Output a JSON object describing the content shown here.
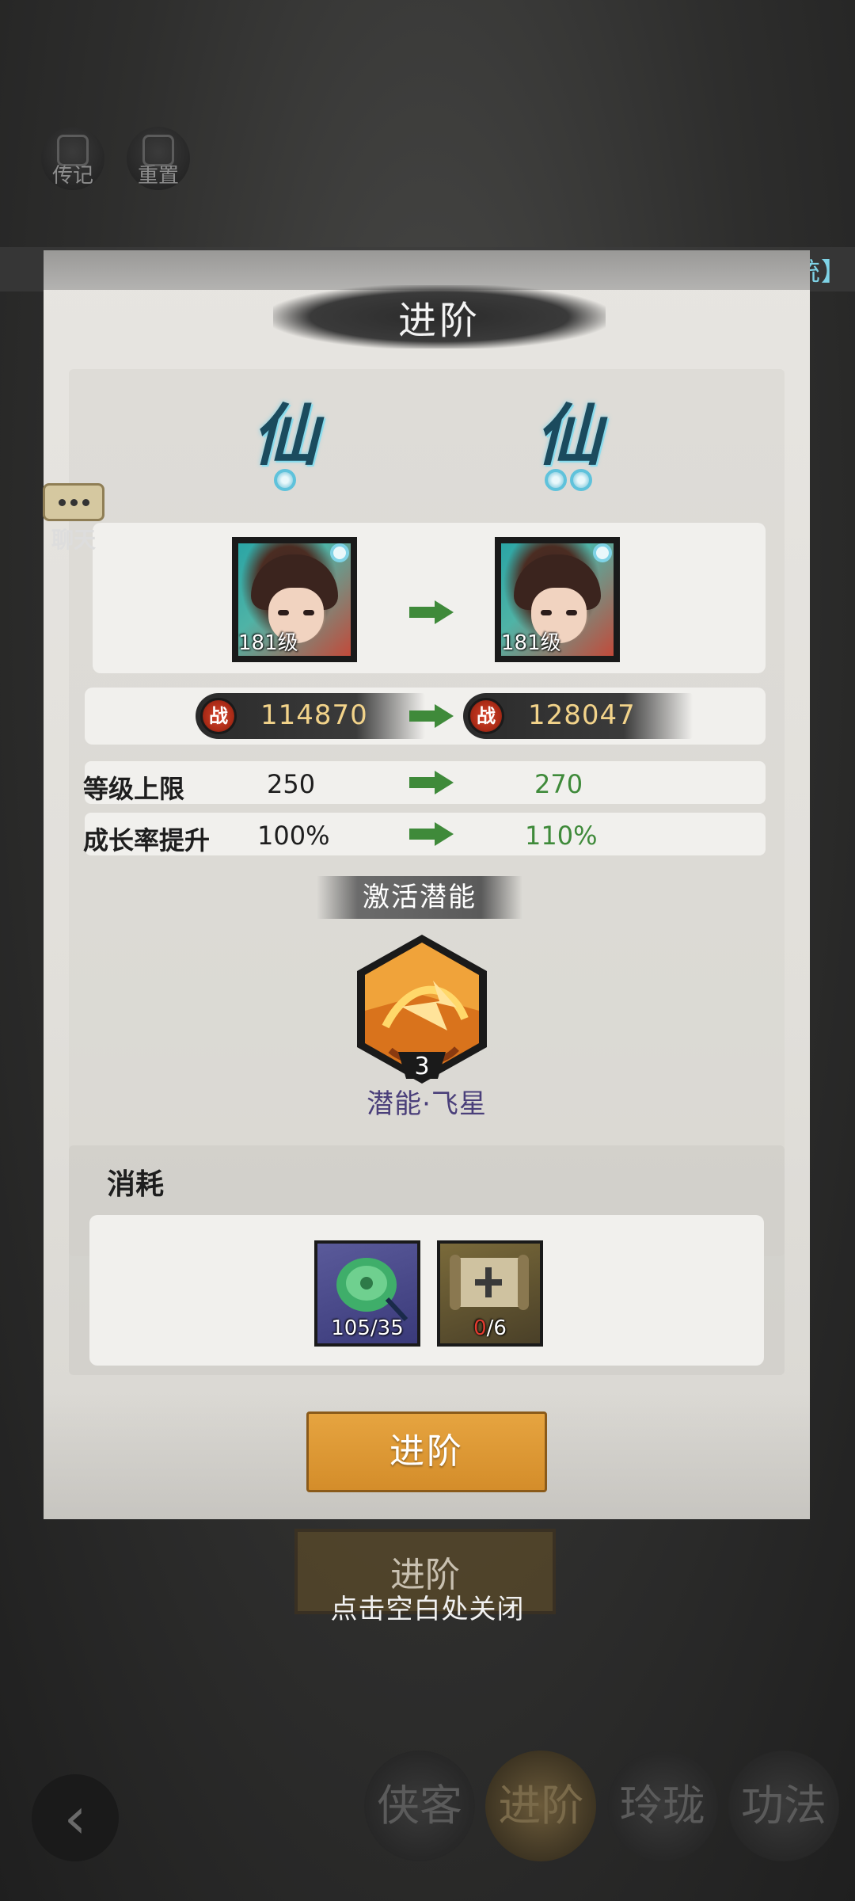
{
  "background": {
    "top_icons": [
      "传记",
      "重置"
    ],
    "system_tag": "【系统】",
    "chat_label": "聊天",
    "under_button_label": "进阶",
    "close_hint": "点击空白处关闭",
    "back_icon": "chevron-left-icon",
    "bottom_tabs": [
      {
        "label": "侠客",
        "active": false
      },
      {
        "label": "进阶",
        "active": true
      },
      {
        "label": "玲珑",
        "active": false
      },
      {
        "label": "功法",
        "active": false
      }
    ]
  },
  "modal": {
    "title": "进阶",
    "rank_glyph": "仙",
    "before": {
      "rank_dots": 1,
      "level_label": "181级",
      "power": "114870"
    },
    "after": {
      "rank_dots": 2,
      "level_label": "181级",
      "power": "128047"
    },
    "power_icon_glyph": "战",
    "stats": [
      {
        "label": "等级上限",
        "old": "250",
        "new": "270"
      },
      {
        "label": "成长率提升",
        "old": "100%",
        "new": "110%"
      }
    ],
    "potential": {
      "title": "激活潜能",
      "skill_level": "3",
      "skill_name": "潜能·飞星"
    },
    "cost": {
      "title": "消耗",
      "items": [
        {
          "name": "jade-token",
          "have": "105",
          "need": "35"
        },
        {
          "name": "scroll",
          "have": "0",
          "need": "6"
        }
      ]
    },
    "advance_button": "进阶"
  },
  "colors": {
    "accent_orange": "#d9952f",
    "increase_green": "#3f8a3a",
    "rank_cyan": "#7fd3e6",
    "lack_red": "#e23b2f"
  }
}
